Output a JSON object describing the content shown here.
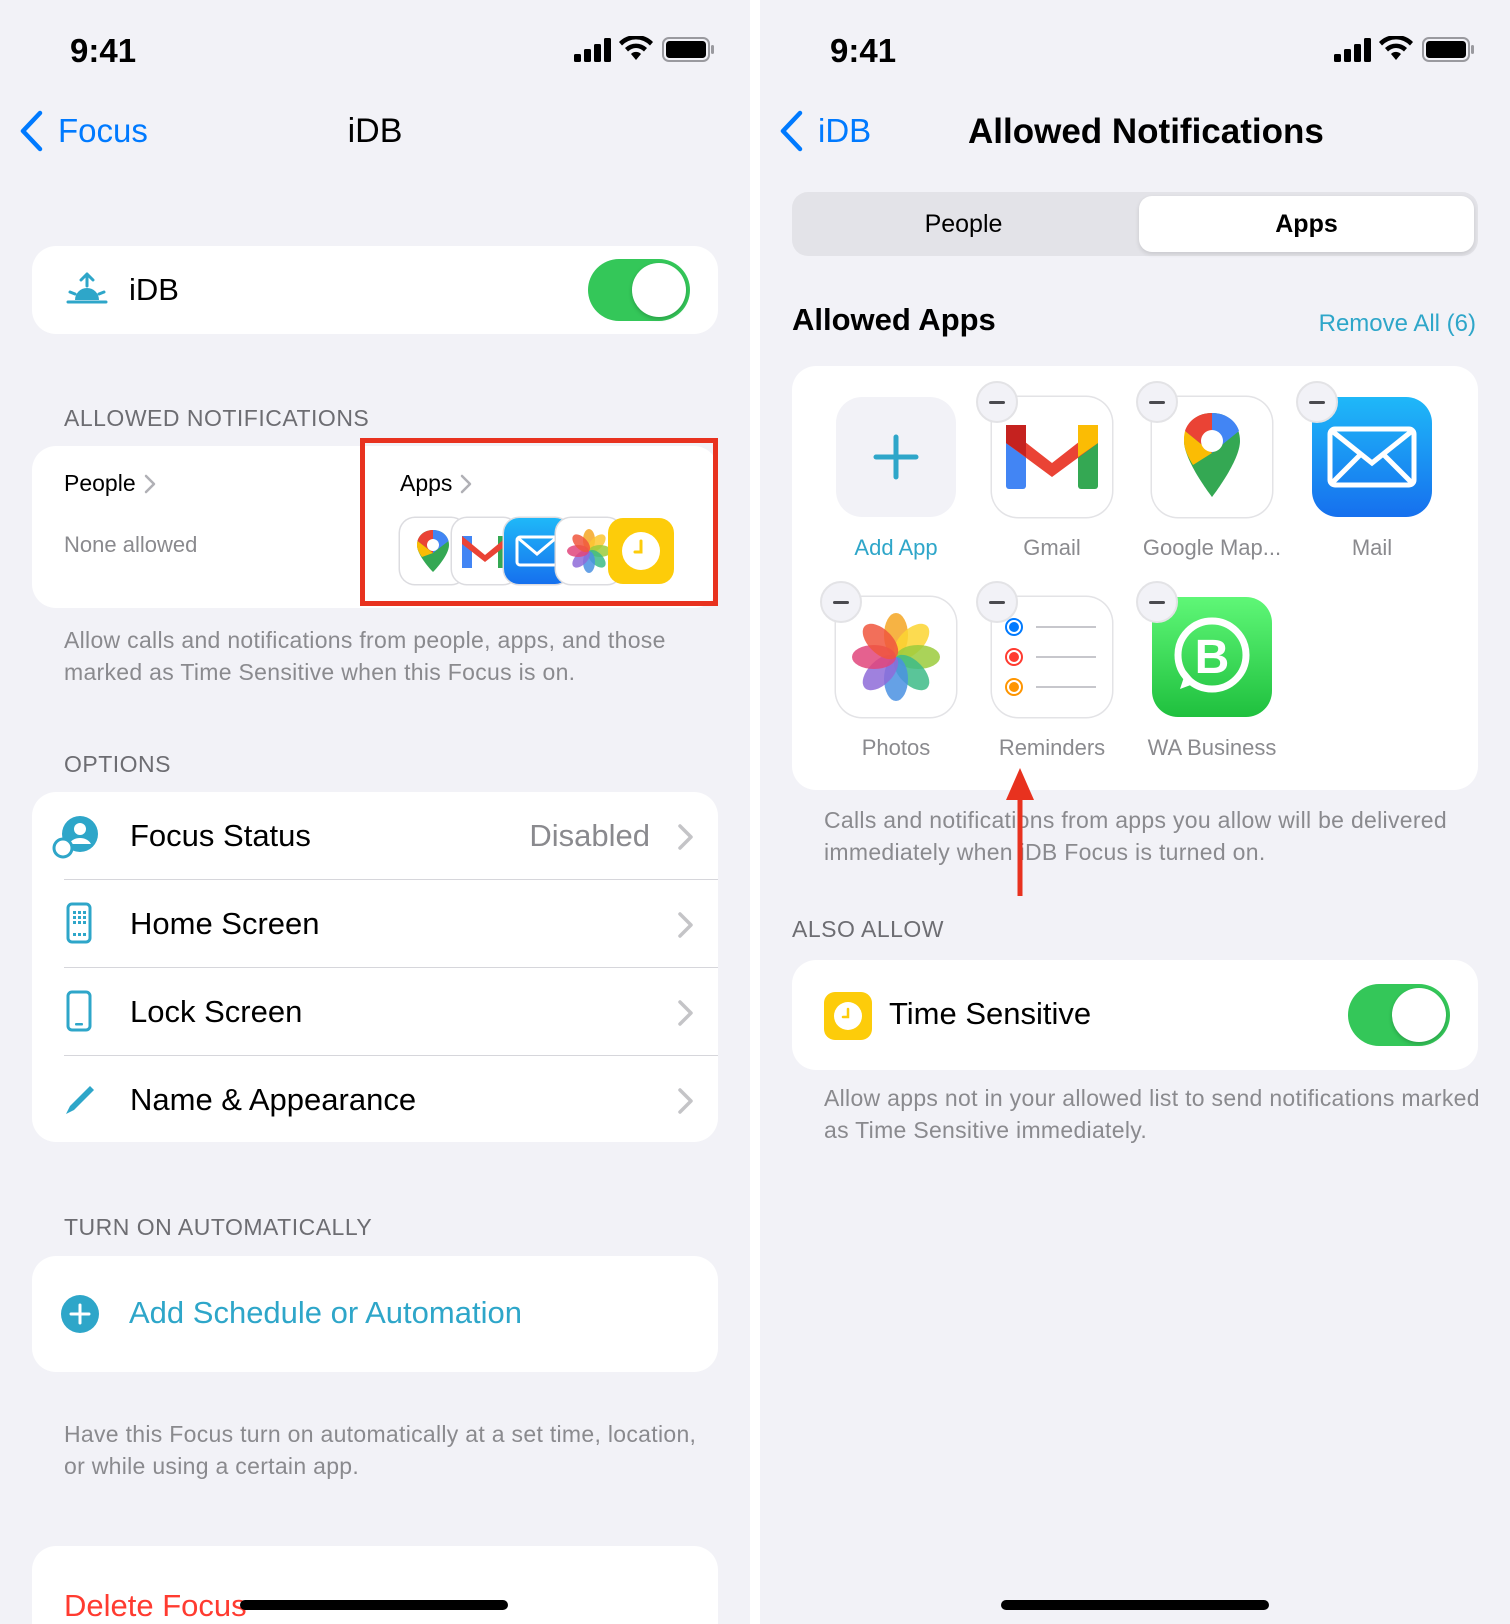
{
  "left": {
    "status": {
      "time": "9:41"
    },
    "nav": {
      "back_label": "Focus",
      "title": "iDB"
    },
    "focus_card": {
      "name": "iDB",
      "enabled": true
    },
    "allowed_header": "ALLOWED NOTIFICATIONS",
    "people": {
      "label": "People",
      "value": "None allowed"
    },
    "apps": {
      "label": "Apps"
    },
    "allowed_footer": "Allow calls and notifications from people, apps, and those marked as Time Sensitive when this Focus is on.",
    "options_header": "OPTIONS",
    "options": [
      {
        "label": "Focus Status",
        "value": "Disabled"
      },
      {
        "label": "Home Screen",
        "value": ""
      },
      {
        "label": "Lock Screen",
        "value": ""
      },
      {
        "label": "Name & Appearance",
        "value": ""
      }
    ],
    "auto_header": "TURN ON AUTOMATICALLY",
    "add_schedule": "Add Schedule or Automation",
    "auto_footer": "Have this Focus turn on automatically at a set time, location, or while using a certain app.",
    "delete_label": "Delete Focus",
    "highlight_color": "#e8321f"
  },
  "right": {
    "status": {
      "time": "9:41"
    },
    "nav": {
      "back_label": "iDB",
      "title": "Allowed Notifications"
    },
    "segments": [
      "People",
      "Apps"
    ],
    "selected_segment": "Apps",
    "allowed_apps_title": "Allowed Apps",
    "remove_all": "Remove All (6)",
    "apps": [
      {
        "name": "Add App",
        "icon": "plus-icon"
      },
      {
        "name": "Gmail",
        "icon": "gmail-icon"
      },
      {
        "name": "Google Map...",
        "icon": "google-maps-icon"
      },
      {
        "name": "Mail",
        "icon": "mail-icon"
      },
      {
        "name": "Photos",
        "icon": "photos-icon"
      },
      {
        "name": "Reminders",
        "icon": "reminders-icon"
      },
      {
        "name": "WA Business",
        "icon": "whatsapp-business-icon"
      }
    ],
    "apps_footer": "Calls and notifications from apps you allow will be delivered immediately when iDB Focus is turned on.",
    "also_allow_header": "ALSO ALLOW",
    "time_sensitive": {
      "label": "Time Sensitive",
      "enabled": true
    },
    "time_sensitive_footer": "Allow apps not in your allowed list to send notifications marked as Time Sensitive immediately.",
    "arrow_color": "#e8321f"
  }
}
